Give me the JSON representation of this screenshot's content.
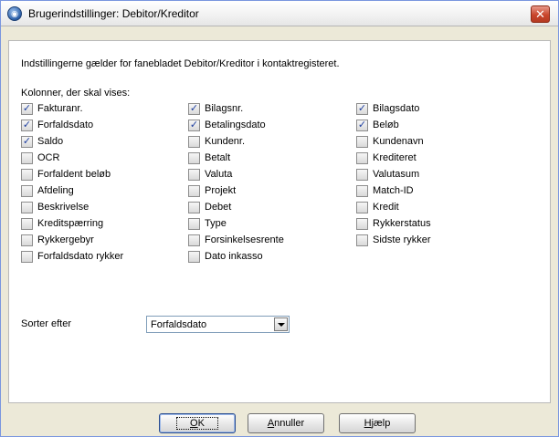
{
  "window": {
    "title": "Brugerindstillinger: Debitor/Kreditor",
    "icon": "app-logo-icon",
    "close_glyph": "✕"
  },
  "intro_text": "Indstillingerne gælder for fanebladet Debitor/Kreditor i kontaktregisteret.",
  "columns_label": "Kolonner, der skal vises:",
  "columns": [
    [
      {
        "label": "Fakturanr.",
        "checked": true
      },
      {
        "label": "Forfaldsdato",
        "checked": true
      },
      {
        "label": "Saldo",
        "checked": true
      },
      {
        "label": "OCR",
        "checked": false
      },
      {
        "label": "Forfaldent beløb",
        "checked": false
      },
      {
        "label": "Afdeling",
        "checked": false
      },
      {
        "label": "Beskrivelse",
        "checked": false
      },
      {
        "label": "Kreditspærring",
        "checked": false
      },
      {
        "label": "Rykkergebyr",
        "checked": false
      },
      {
        "label": "Forfaldsdato rykker",
        "checked": false
      }
    ],
    [
      {
        "label": "Bilagsnr.",
        "checked": true
      },
      {
        "label": "Betalingsdato",
        "checked": true
      },
      {
        "label": "Kundenr.",
        "checked": false
      },
      {
        "label": "Betalt",
        "checked": false
      },
      {
        "label": "Valuta",
        "checked": false
      },
      {
        "label": "Projekt",
        "checked": false
      },
      {
        "label": "Debet",
        "checked": false
      },
      {
        "label": "Type",
        "checked": false
      },
      {
        "label": "Forsinkelsesrente",
        "checked": false
      },
      {
        "label": "Dato inkasso",
        "checked": false
      }
    ],
    [
      {
        "label": "Bilagsdato",
        "checked": true
      },
      {
        "label": "Beløb",
        "checked": true
      },
      {
        "label": "Kundenavn",
        "checked": false
      },
      {
        "label": "Krediteret",
        "checked": false
      },
      {
        "label": "Valutasum",
        "checked": false
      },
      {
        "label": "Match-ID",
        "checked": false
      },
      {
        "label": "Kredit",
        "checked": false
      },
      {
        "label": "Rykkerstatus",
        "checked": false
      },
      {
        "label": "Sidste rykker",
        "checked": false
      }
    ]
  ],
  "sort": {
    "label": "Sorter efter",
    "value": "Forfaldsdato"
  },
  "buttons": {
    "ok": {
      "key": "O",
      "rest": "K"
    },
    "cancel": {
      "key": "A",
      "rest": "nnuller"
    },
    "help": {
      "key": "H",
      "rest": "jælp"
    }
  },
  "colors": {
    "check_mark": "#1f3fa0",
    "close_button": "#c9462c",
    "title_bar": "#f1f1f1"
  }
}
